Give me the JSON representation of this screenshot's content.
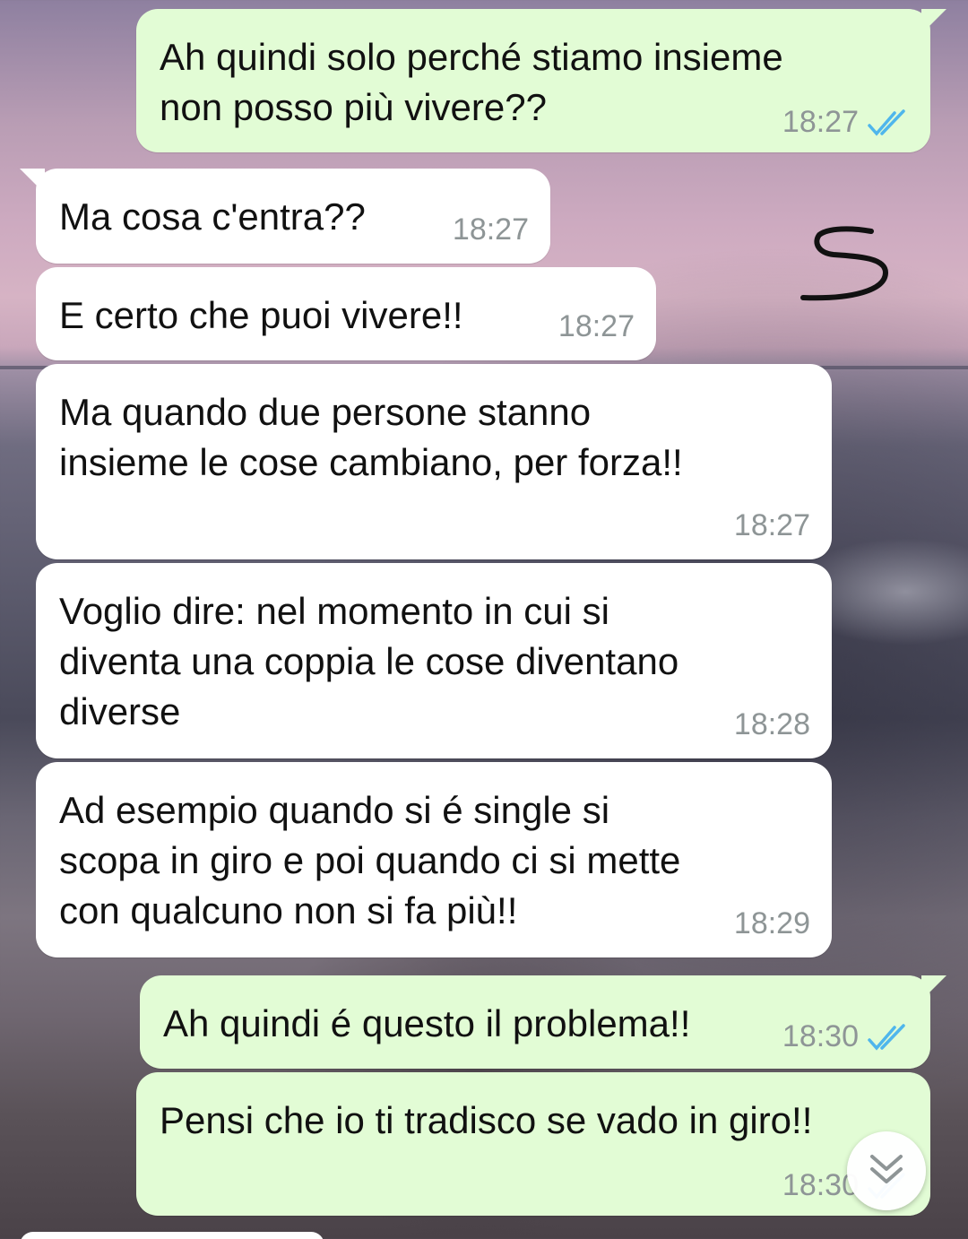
{
  "colors": {
    "outgoing_bubble": "#e2fcd5",
    "incoming_bubble": "#ffffff",
    "read_ticks": "#4fb6ec",
    "timestamp": "#8e9596"
  },
  "annotation": {
    "mark": "5"
  },
  "messages": [
    {
      "direction": "out",
      "text": "Ah quindi solo perché stiamo insieme\nnon posso più vivere??",
      "time": "18:27",
      "read_icon": "double-check-icon"
    },
    {
      "direction": "in",
      "text": "Ma cosa c'entra??",
      "time": "18:27"
    },
    {
      "direction": "in",
      "text": "E certo che puoi vivere!!",
      "time": "18:27"
    },
    {
      "direction": "in",
      "text": "Ma quando due persone stanno\ninsieme le cose cambiano, per forza!!",
      "time": "18:27"
    },
    {
      "direction": "in",
      "text": "Voglio dire: nel momento in cui si\ndiventa una coppia le cose diventano\ndiverse",
      "time": "18:28"
    },
    {
      "direction": "in",
      "text": "Ad esempio quando si é single si\nscopa in giro e poi quando ci si mette\ncon qualcuno non si fa più!!",
      "time": "18:29"
    },
    {
      "direction": "out",
      "text": "Ah quindi é questo il problema!!",
      "time": "18:30",
      "read_icon": "double-check-icon"
    },
    {
      "direction": "out",
      "text": "Pensi che io ti tradisco se vado in giro!!",
      "time": "18:30",
      "read_icon": "double-check-icon"
    }
  ],
  "scroll_button": {
    "icon": "double-chevron-down-icon"
  }
}
